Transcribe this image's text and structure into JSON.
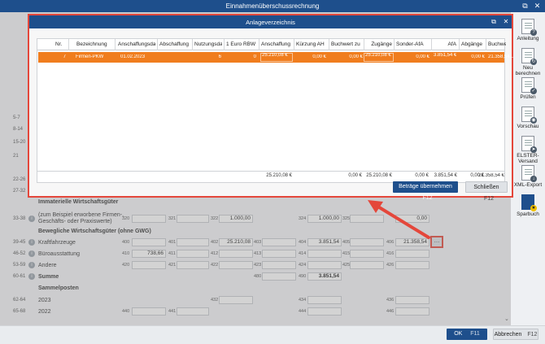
{
  "window": {
    "title": "Einnahmenüberschussrechnung"
  },
  "line_numbers_left": [
    "5-7",
    "8-14",
    "15-20",
    "21",
    "22-26",
    "27-32"
  ],
  "sections": {
    "immaterielle": "Immaterielle Wirtschaftsgüter",
    "bewegliche": "Bewegliche Wirtschaftsgüter (ohne GWG)",
    "sammelposten": "Sammelposten"
  },
  "rows": [
    {
      "num": "33-38",
      "label": "(zum Beispiel erworbene Firmen-, Geschäfts- oder Praxiswerte)",
      "f1": "320",
      "v1": "",
      "f2": "321",
      "v2": "",
      "f3": "322",
      "v3": "1.000,00",
      "f4": "324",
      "v4": "1.000,00",
      "f5": "325",
      "v5": "",
      "f6": "",
      "v6": "0,00"
    },
    {
      "num": "39-45",
      "label": "Kraftfahrzeuge",
      "f1": "400",
      "v1": "",
      "f2": "401",
      "v2": "",
      "f3": "402",
      "v3": "25.210,08",
      "f3b": "403",
      "f4": "404",
      "v4": "3.851,54",
      "f5": "405",
      "v5": "",
      "f6": "406",
      "v6": "21.358,54"
    },
    {
      "num": "46-52",
      "label": "Büroausstattung",
      "f1": "410",
      "v1": "738,66",
      "f2": "411",
      "v2": "",
      "f3": "412",
      "v3": "",
      "f3b": "413",
      "f4": "414",
      "v4": "",
      "f5": "415",
      "v5": "",
      "f6": "416",
      "v6": ""
    },
    {
      "num": "53-59",
      "label": "Andere",
      "f1": "420",
      "v1": "",
      "f2": "421",
      "v2": "",
      "f3": "422",
      "v3": "",
      "f3b": "423",
      "f4": "424",
      "v4": "",
      "f5": "425",
      "v5": "",
      "f6": "426",
      "v6": ""
    },
    {
      "num": "60-61",
      "label": "Summe",
      "f4a": "480",
      "f4": "490",
      "v4": "3.851,54"
    },
    {
      "num": "62-64",
      "label": "2023",
      "f3": "432",
      "f4": "434",
      "f6": "436"
    },
    {
      "num": "65-68",
      "label": "2022",
      "f1": "440",
      "f2": "441",
      "f4": "444",
      "f6": "446"
    }
  ],
  "right_panel": [
    {
      "label": "Anleitung",
      "icon": "book-icon"
    },
    {
      "label": "Neu berechnen",
      "icon": "recalc-icon"
    },
    {
      "label": "Prüfen",
      "icon": "check-icon"
    },
    {
      "label": "Vorschau",
      "icon": "preview-icon"
    },
    {
      "label": "ELSTER-Versand",
      "icon": "send-icon"
    },
    {
      "label": "XML-Export",
      "icon": "xml-icon"
    },
    {
      "label": "Sparbuch",
      "icon": "book-brand-icon"
    }
  ],
  "footer": {
    "ok": "OK",
    "ok_key": "F11",
    "cancel": "Abbrechen",
    "cancel_key": "F12"
  },
  "modal": {
    "title": "Anlageverzeichnis",
    "columns": [
      "Nr.",
      "Bezeichnung",
      "Anschaffungsdat",
      "Abschaffung",
      "Nutzungsda",
      "1 Euro RBW",
      "Anschaffung",
      "Kürzung AH",
      "Buchwert zu",
      "Zugänge",
      "Sonder-AfA",
      "AfA",
      "Abgänge",
      "Buchwert am"
    ],
    "row": [
      "7",
      "Firmen-PKW",
      "01.02.2023",
      "",
      "6",
      "0",
      "25.210,08 €",
      "0,00 €",
      "0,00 €",
      "25.210,08 €",
      "0,00 €",
      "3.851,54 €",
      "0,00 €",
      "21.358,54..."
    ],
    "totals": [
      "",
      "",
      "",
      "",
      "",
      "",
      "25.210,08 €",
      "",
      "0,00 €",
      "25.210,08 €",
      "0,00 €",
      "3.851,54 €",
      "0,00 €",
      "21.358,54 €"
    ],
    "apply_button": "Beträge übernehmen",
    "apply_key": "F12",
    "close_button": "Schließen",
    "close_key": "F12"
  },
  "colors": {
    "titlebar": "#1e4f8c",
    "selected_row": "#f07d1e",
    "highlight": "#e4473b"
  }
}
